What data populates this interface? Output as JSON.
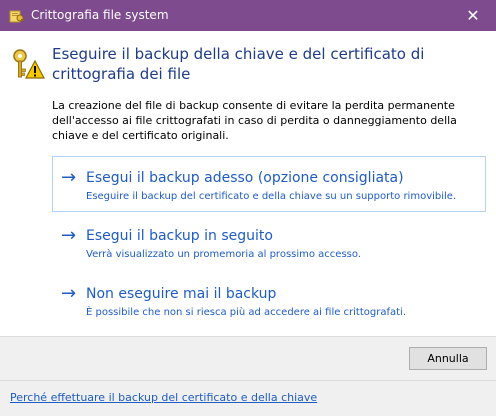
{
  "window": {
    "title": "Crittografia file system",
    "close_glyph": "✕",
    "app_icon": "certificate-key-icon"
  },
  "header": {
    "icon": "key-warning-icon",
    "title": "Eseguire il backup della chiave e del certificato di crittografia dei file"
  },
  "description": "La creazione del file di backup consente di evitare la perdita permanente dell'accesso ai file crittografati in caso di perdita o danneggiamento della chiave e del certificato originali.",
  "options": [
    {
      "arrow": "→",
      "title": "Esegui il backup adesso (opzione consigliata)",
      "subtitle": "Eseguire il backup del certificato e della chiave su un supporto rimovibile."
    },
    {
      "arrow": "→",
      "title": "Esegui il backup in seguito",
      "subtitle": "Verrà visualizzato un promemoria al prossimo accesso."
    },
    {
      "arrow": "→",
      "title": "Non eseguire mai il backup",
      "subtitle": "È possibile che non si riesca più ad accedere ai file crittografati."
    }
  ],
  "buttons": {
    "cancel": "Annulla"
  },
  "footer": {
    "help_link": "Perché effettuare il backup del certificato e della chiave"
  },
  "colors": {
    "titlebar": "#7d4b8e",
    "heading": "#1f3c88",
    "link": "#1e5cc4",
    "selected_border": "#b4d4f5"
  }
}
